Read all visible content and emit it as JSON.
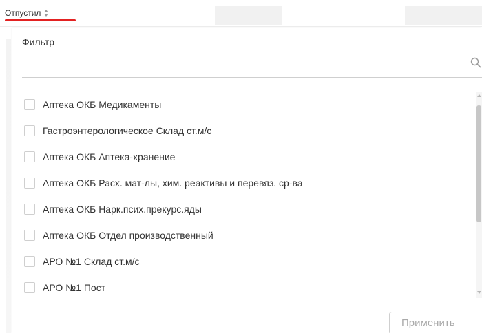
{
  "header": {
    "column_label": "Отпустил"
  },
  "filter": {
    "label": "Фильтр",
    "input_value": "",
    "input_placeholder": ""
  },
  "options": [
    {
      "label": "Аптека ОКБ Медикаменты",
      "checked": false
    },
    {
      "label": "Гастроэнтерологическое Склад ст.м/с",
      "checked": false
    },
    {
      "label": "Аптека ОКБ Аптека-хранение",
      "checked": false
    },
    {
      "label": "Аптека ОКБ Расх. мат-лы, хим. реактивы и перевяз. ср-ва",
      "checked": false
    },
    {
      "label": "Аптека ОКБ Нарк.псих.прекурс.яды",
      "checked": false
    },
    {
      "label": "Аптека ОКБ Отдел производственный",
      "checked": false
    },
    {
      "label": "АРО №1 Склад ст.м/с",
      "checked": false
    },
    {
      "label": "АРО №1 Пост",
      "checked": false
    }
  ],
  "buttons": {
    "apply_label": "Применить"
  },
  "colors": {
    "accent_underline": "#e32222",
    "checkbox_border": "#cfcfcf",
    "disabled_button_text": "#a9a9a9"
  },
  "icons": {
    "sort": "sort-icon",
    "search": "search-icon"
  }
}
